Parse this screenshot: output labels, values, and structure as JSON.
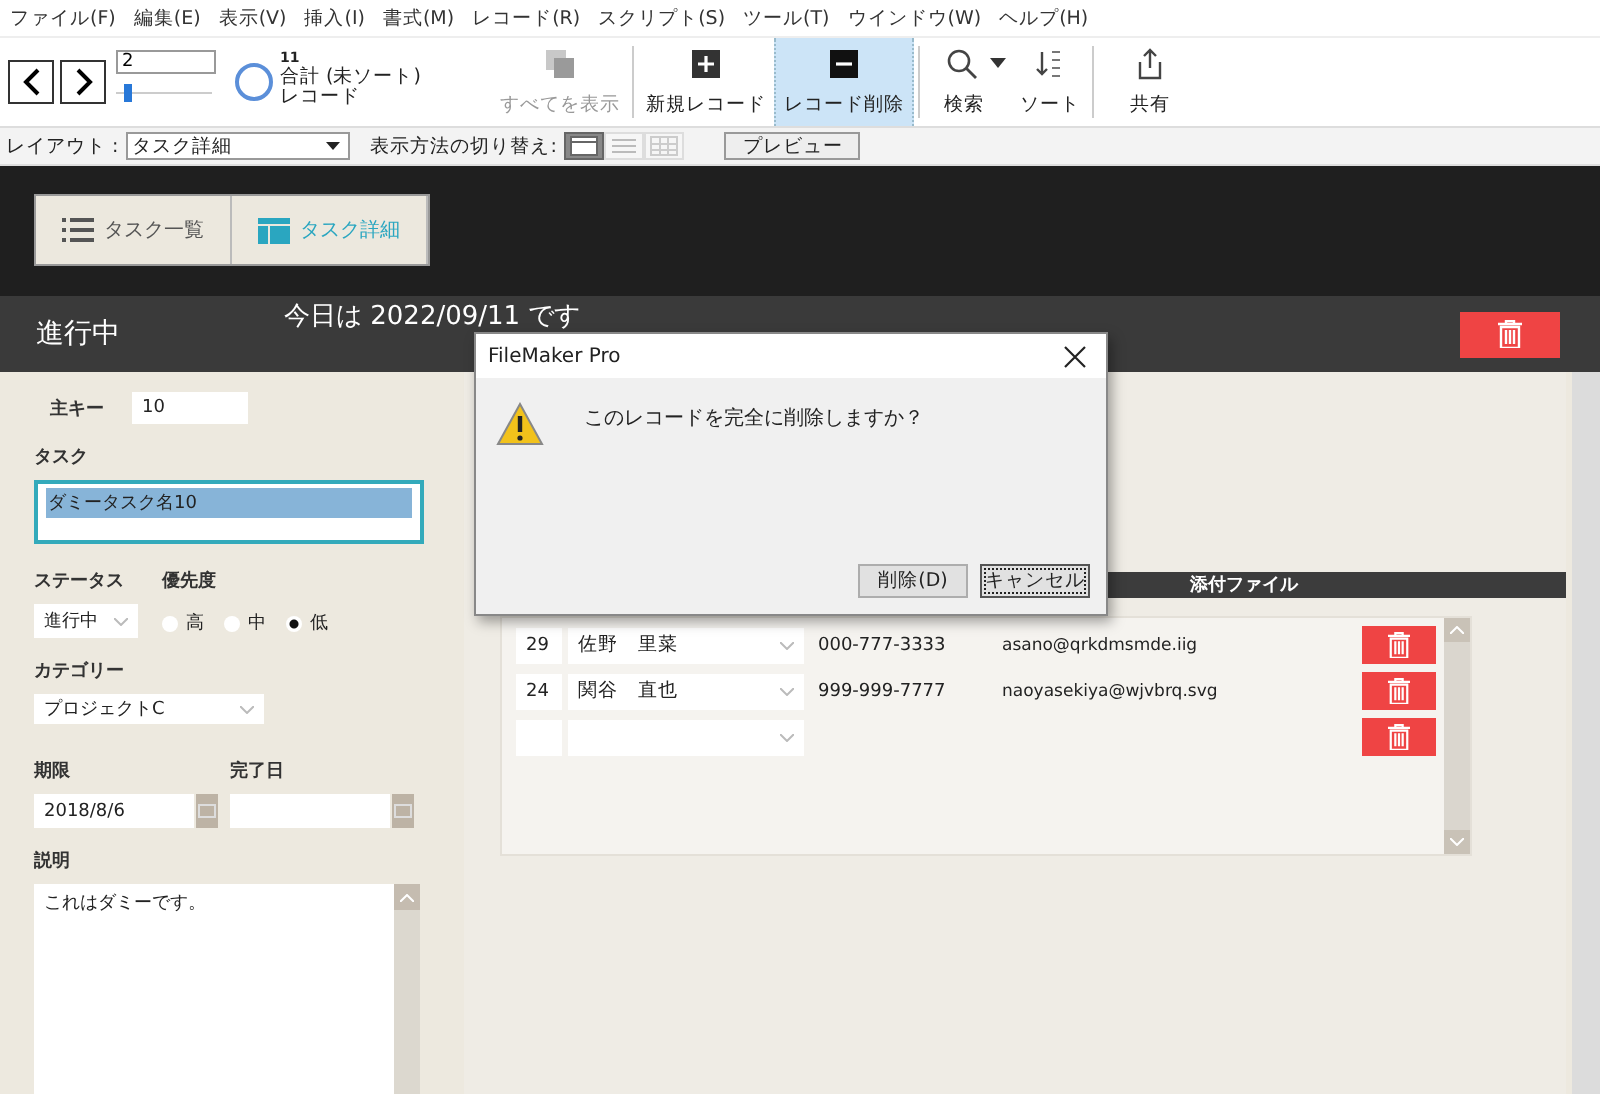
{
  "menu": [
    "ファイル(F)",
    "編集(E)",
    "表示(V)",
    "挿入(I)",
    "書式(M)",
    "レコード(R)",
    "スクリプト(S)",
    "ツール(T)",
    "ウインドウ(W)",
    "ヘルプ(H)"
  ],
  "toolbar": {
    "record": "2",
    "slider": {
      "level": 0.08
    },
    "found": "11",
    "total": "合計 (未ソート)",
    "unit": "レコード",
    "buttons": [
      {
        "kind": "showall",
        "label": "すべてを表示",
        "disabled": true,
        "selected": false
      },
      {
        "kind": "new",
        "label": "新規レコード",
        "disabled": false,
        "selected": false
      },
      {
        "kind": "delete",
        "label": "レコード削除",
        "disabled": false,
        "selected": true
      },
      {
        "kind": "find",
        "label": "検索",
        "disabled": false,
        "selected": false
      },
      {
        "kind": "sort",
        "label": "ソート",
        "disabled": false,
        "selected": false
      },
      {
        "kind": "share",
        "label": "共有",
        "disabled": false,
        "selected": false
      }
    ]
  },
  "layout_bar": {
    "label": "レイアウト :",
    "layout": "タスク詳細",
    "view_label": "表示方法の切り替え:",
    "views": [
      {
        "kind": "form",
        "selected": true
      },
      {
        "kind": "list",
        "selected": false
      },
      {
        "kind": "table",
        "selected": false
      }
    ],
    "preview": "プレビュー"
  },
  "nav_tabs": [
    {
      "kind": "list",
      "label": "タスク一覧",
      "selected": false
    },
    {
      "kind": "detail",
      "label": "タスク詳細",
      "selected": true
    }
  ],
  "header": {
    "status": "進行中",
    "today": "今日は 2022/09/11 です"
  },
  "form": {
    "key_label": "主キー",
    "key": "10",
    "task_label": "タスク",
    "task": "ダミータスク名10",
    "status_label": "ステータス",
    "status": "進行中",
    "priority_label": "優先度",
    "priorities": [
      {
        "label": "高",
        "selected": false
      },
      {
        "label": "中",
        "selected": false
      },
      {
        "label": "低",
        "selected": true
      }
    ],
    "category_label": "カテゴリー",
    "category": "プロジェクトC",
    "due_label": "期限",
    "due": "2018/8/6",
    "done_label": "完了日",
    "desc_label": "説明",
    "desc": "これはダミーです。"
  },
  "portal": {
    "header": "添付ファイル",
    "rows": [
      {
        "kind": "filled",
        "id": "29",
        "name": "佐野　里菜",
        "phone": "000-777-3333",
        "email": "asano@qrkdmsmde.iig"
      },
      {
        "kind": "filled",
        "id": "24",
        "name": "関谷　直也",
        "phone": "999-999-7777",
        "email": "naoyasekiya@wjvbrq.svg"
      },
      {
        "kind": "empty"
      }
    ]
  },
  "dialog": {
    "title": "FileMaker Pro",
    "message": "このレコードを完全に削除しますか？",
    "buttons": [
      {
        "label": "削除(D)",
        "focused": false
      },
      {
        "label": "キャンセル",
        "focused": true
      }
    ]
  }
}
